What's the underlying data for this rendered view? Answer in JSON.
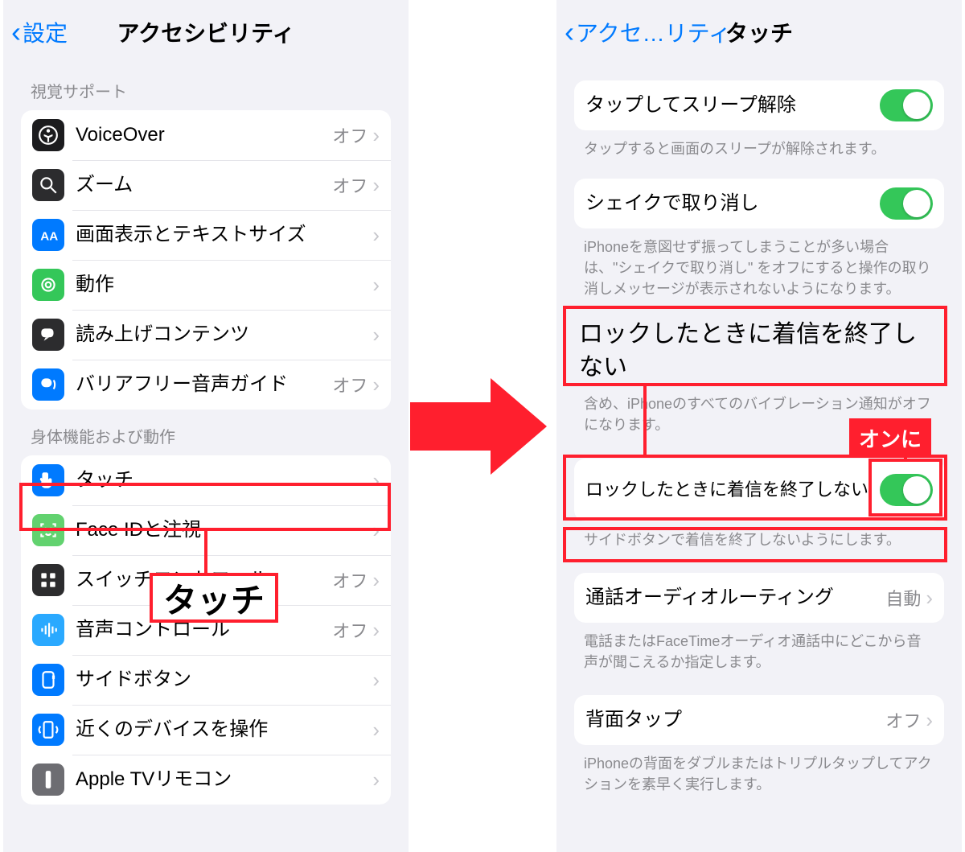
{
  "left": {
    "back": "設定",
    "title": "アクセシビリティ",
    "section_vision": "視覚サポート",
    "section_physical": "身体機能および動作",
    "off": "オフ",
    "items_vision": [
      {
        "label": "VoiceOver",
        "val": "オフ",
        "icon": "accessibility-icon"
      },
      {
        "label": "ズーム",
        "val": "オフ",
        "icon": "zoom-icon"
      },
      {
        "label": "画面表示とテキストサイズ",
        "val": "",
        "icon": "text-size-icon"
      },
      {
        "label": "動作",
        "val": "",
        "icon": "motion-icon"
      },
      {
        "label": "読み上げコンテンツ",
        "val": "",
        "icon": "speech-icon"
      },
      {
        "label": "バリアフリー音声ガイド",
        "val": "オフ",
        "icon": "audio-desc-icon"
      }
    ],
    "items_physical": [
      {
        "label": "タッチ",
        "val": "",
        "icon": "touch-icon"
      },
      {
        "label": "Face IDと注視",
        "val": "",
        "icon": "faceid-icon"
      },
      {
        "label": "スイッチコントロール",
        "val": "オフ",
        "icon": "switch-control-icon"
      },
      {
        "label": "音声コントロール",
        "val": "オフ",
        "icon": "voice-control-icon"
      },
      {
        "label": "サイドボタン",
        "val": "",
        "icon": "side-button-icon"
      },
      {
        "label": "近くのデバイスを操作",
        "val": "",
        "icon": "nearby-device-icon"
      },
      {
        "label": "Apple TVリモコン",
        "val": "",
        "icon": "appletv-remote-icon"
      }
    ]
  },
  "right": {
    "back": "アクセ…リティ",
    "title": "タッチ",
    "tap_wake": {
      "label": "タップしてスリープ解除",
      "on": true
    },
    "tap_wake_foot": "タップすると画面のスリープが解除されます。",
    "shake": {
      "label": "シェイクで取り消し",
      "on": true
    },
    "shake_foot": "iPhoneを意図せず振ってしまうことが多い場合は、\"シェイクで取り消し\" をオフにすると操作の取り消しメッセージが表示されないようになります。",
    "lock_call_title": "ロックしたときに着信を終了しない",
    "lock_call_foot_above": "含め、iPhoneのすべてのバイブレーション通知がオフになります。",
    "lock_call": {
      "label": "ロックしたときに着信を終了しない",
      "on": true
    },
    "lock_call_foot": "サイドボタンで着信を終了しないようにします。",
    "audio_route": {
      "label": "通話オーディオルーティング",
      "val": "自動"
    },
    "audio_route_foot": "電話またはFaceTimeオーディオ通話中にどこから音声が聞こえるか指定します。",
    "back_tap": {
      "label": "背面タップ",
      "val": "オフ"
    },
    "back_tap_foot": "iPhoneの背面をダブルまたはトリプルタップしてアクションを素早く実行します。"
  },
  "annotations": {
    "touch_callout": "タッチ",
    "on_tag": "オンに"
  }
}
